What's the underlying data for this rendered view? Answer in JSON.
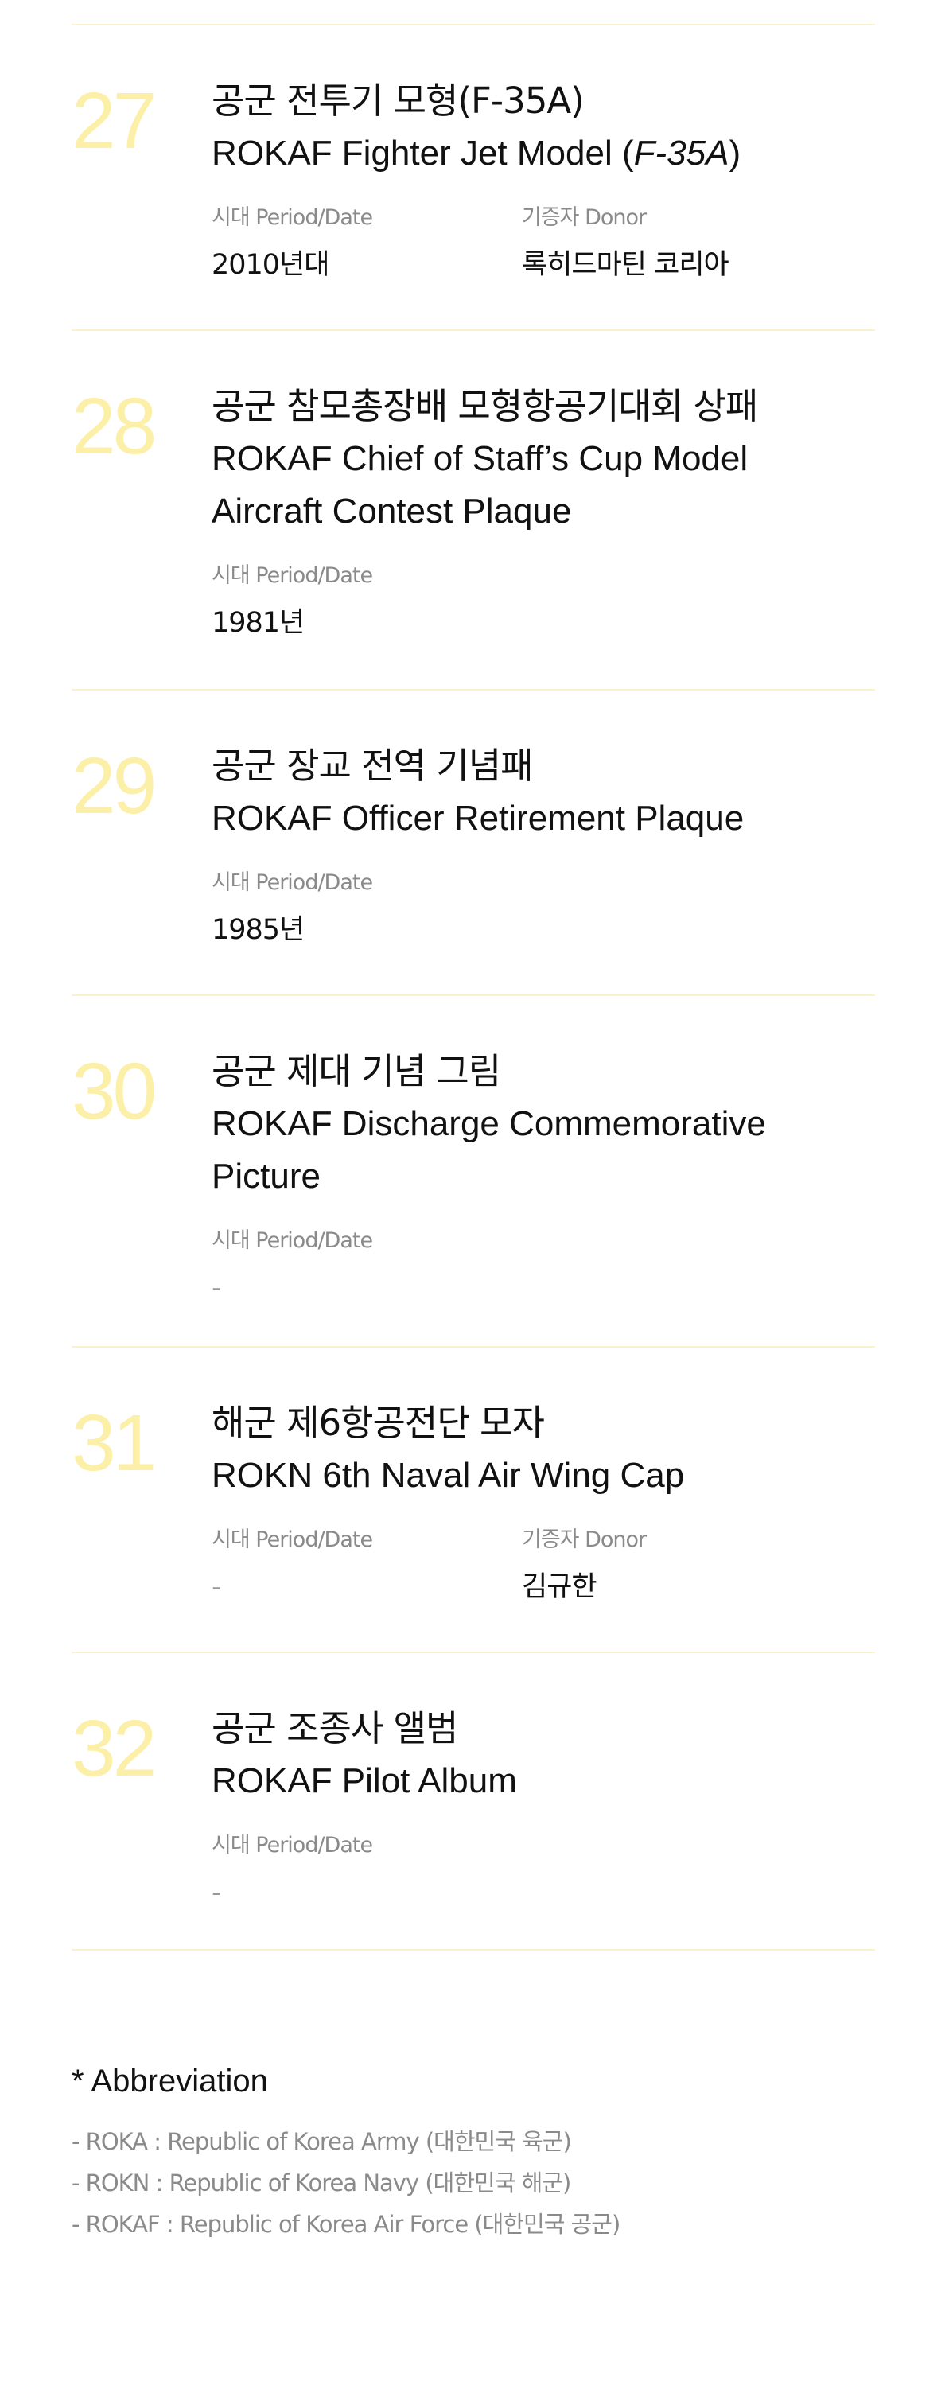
{
  "items": [
    {
      "number": "27",
      "title_ko": "공군 전투기 모형(F-35A)",
      "title_en_prefix": "ROKAF Fighter Jet Model (",
      "title_en_italic": "F-35A",
      "title_en_suffix": ")",
      "period_label": "시대 Period/Date",
      "period_value": "2010년대",
      "donor_label": "기증자 Donor",
      "donor_value": "록히드마틴 코리아"
    },
    {
      "number": "28",
      "title_ko": "공군 참모총장배 모형항공기대회 상패",
      "title_en": "ROKAF Chief of Staff’s Cup Model Aircraft Contest Plaque",
      "period_label": "시대 Period/Date",
      "period_value": "1981년"
    },
    {
      "number": "29",
      "title_ko": "공군 장교 전역 기념패",
      "title_en": "ROKAF Officer Retirement Plaque",
      "period_label": "시대 Period/Date",
      "period_value": "1985년"
    },
    {
      "number": "30",
      "title_ko": "공군 제대 기념 그림",
      "title_en": "ROKAF Discharge Commemorative Picture",
      "period_label": "시대 Period/Date",
      "period_value": "-"
    },
    {
      "number": "31",
      "title_ko": "해군 제6항공전단 모자",
      "title_en": "ROKN 6th Naval Air Wing Cap",
      "period_label": "시대 Period/Date",
      "period_value": "-",
      "donor_label": "기증자 Donor",
      "donor_value": "김규한"
    },
    {
      "number": "32",
      "title_ko": "공군 조종사 앨범",
      "title_en": "ROKAF Pilot Album",
      "period_label": "시대 Period/Date",
      "period_value": "-"
    }
  ],
  "abbreviation": {
    "title": "* Abbreviation",
    "lines": [
      "- ROKA : Republic of Korea Army (대한민국 육군)",
      "- ROKN : Republic of Korea Navy (대한민국 해군)",
      "- ROKAF : Republic of Korea Air Force (대한민국 공군)"
    ]
  }
}
